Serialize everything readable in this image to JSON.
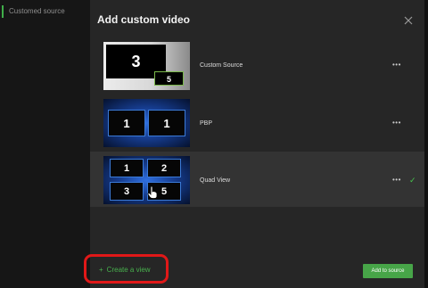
{
  "sidebar": {
    "label": "Customed source"
  },
  "modal": {
    "title": "Add custom video",
    "views": [
      {
        "label": "Custom Source",
        "more": "•••",
        "thumb": {
          "main": "3",
          "inset": "5"
        }
      },
      {
        "label": "PBP",
        "more": "•••",
        "thumb": {
          "left": "1",
          "right": "1"
        }
      },
      {
        "label": "Quad View",
        "more": "•••",
        "selected": true,
        "check": "✓",
        "thumb": {
          "q1": "1",
          "q2": "2",
          "q3": "3",
          "q4": "5"
        }
      }
    ],
    "create_view": {
      "icon": "+",
      "label": "Create a view"
    },
    "add_button": "Add to source"
  },
  "colors": {
    "accent": "#47a548",
    "highlight": "#e01818",
    "modal_bg": "#262626",
    "selected_row": "#333333"
  },
  "icons": {
    "close": "close-icon",
    "plus": "plus-icon",
    "more": "more-icon",
    "check": "check-icon",
    "cursor": "hand-cursor-icon"
  }
}
